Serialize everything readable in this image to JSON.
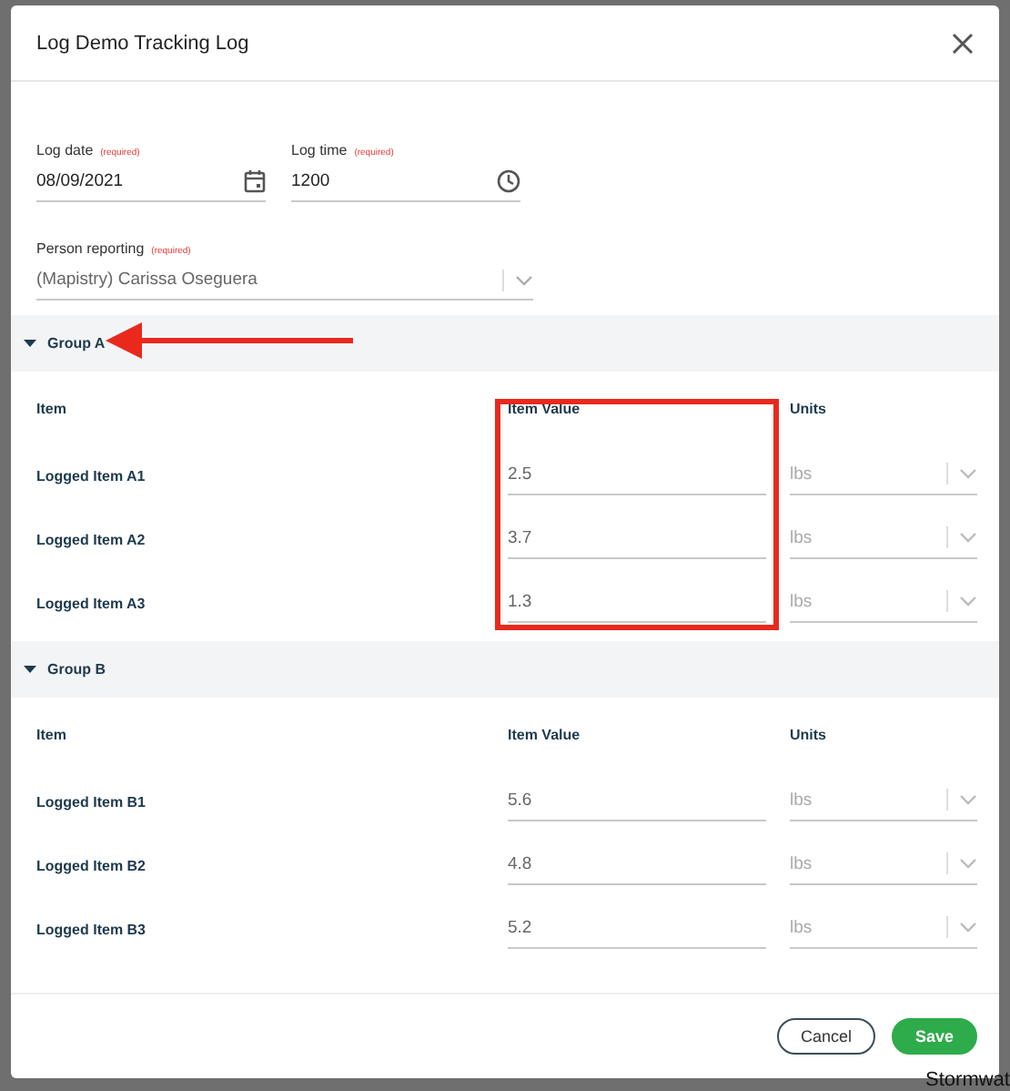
{
  "dialog": {
    "title": "Log Demo Tracking Log"
  },
  "fields": [
    {
      "label": "Log date",
      "required_note": "(required)",
      "value": "08/09/2021",
      "kind": "date"
    },
    {
      "label": "Log time",
      "required_note": "(required)",
      "value": "1200",
      "kind": "time"
    }
  ],
  "person": {
    "label": "Person reporting",
    "required_note": "(required)",
    "value": "(Mapistry) Carissa Oseguera"
  },
  "groups": [
    {
      "title": "Group A",
      "expanded": true,
      "columns": [
        "Item",
        "Item Value",
        "Units"
      ],
      "rows": [
        {
          "item": "Logged Item A1",
          "value": "2.5",
          "units": "lbs"
        },
        {
          "item": "Logged Item A2",
          "value": "3.7",
          "units": "lbs"
        },
        {
          "item": "Logged Item A3",
          "value": "1.3",
          "units": "lbs"
        }
      ]
    },
    {
      "title": "Group B",
      "expanded": true,
      "columns": [
        "Item",
        "Item Value",
        "Units"
      ],
      "rows": [
        {
          "item": "Logged Item B1",
          "value": "5.6",
          "units": "lbs"
        },
        {
          "item": "Logged Item B2",
          "value": "4.8",
          "units": "lbs"
        },
        {
          "item": "Logged Item B3",
          "value": "5.2",
          "units": "lbs"
        }
      ]
    }
  ],
  "buttons": [
    {
      "label": "Cancel",
      "kind": "secondary"
    },
    {
      "label": "Save",
      "kind": "primary"
    }
  ],
  "background": {
    "text": "Stormwat"
  }
}
